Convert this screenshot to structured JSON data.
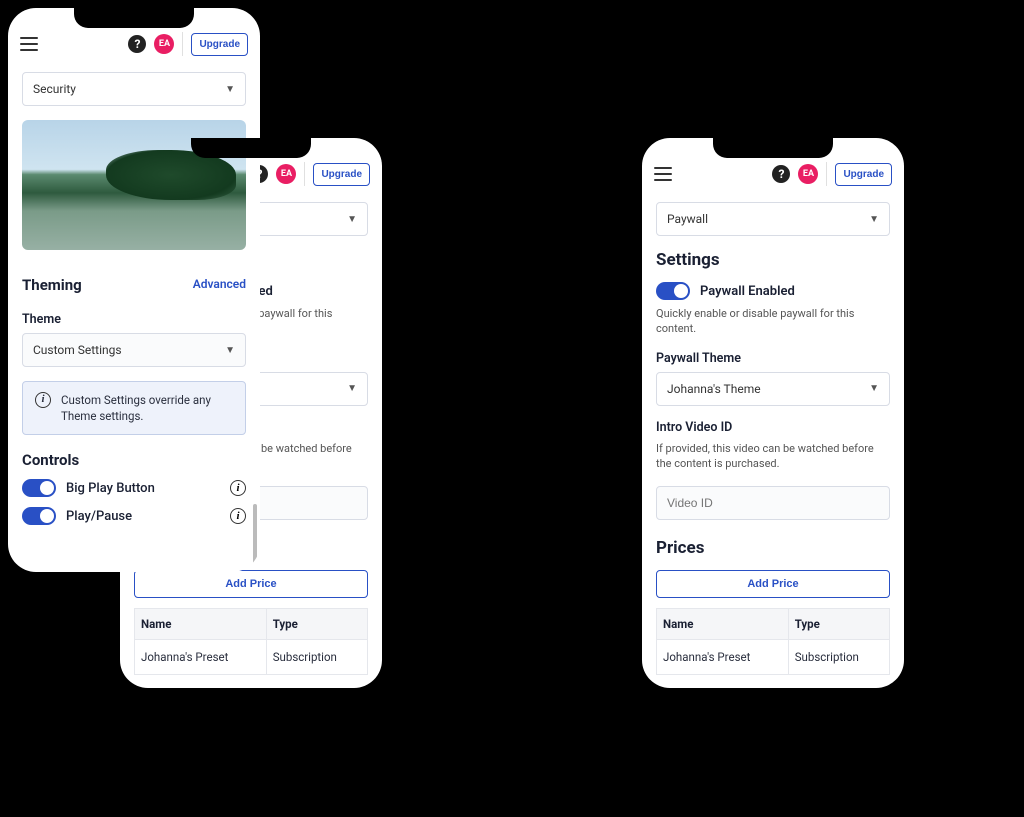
{
  "header": {
    "upgrade_label": "Upgrade",
    "avatar_text": "EA",
    "help_text": "?"
  },
  "side_phone": {
    "dropdown_value": "Paywall",
    "settings_heading": "Settings",
    "toggle_label": "Paywall Enabled",
    "toggle_helper": "Quickly enable or disable paywall for this content.",
    "theme_label": "Paywall Theme",
    "theme_value": "Johanna's Theme",
    "intro_label": "Intro Video ID",
    "intro_helper": "If provided, this video can be watched before the content is purchased.",
    "intro_placeholder": "Video ID",
    "prices_heading": "Prices",
    "add_price_label": "Add Price",
    "table": {
      "col_name": "Name",
      "col_type": "Type",
      "row_name": "Johanna's Preset",
      "row_type": "Subscription"
    }
  },
  "center_phone": {
    "dropdown_value": "Security",
    "theming_heading": "Theming",
    "advanced_link": "Advanced",
    "theme_label": "Theme",
    "theme_value": "Custom Settings",
    "info_text": "Custom Settings override any Theme settings.",
    "controls_heading": "Controls",
    "control1": "Big Play Button",
    "control2": "Play/Pause"
  }
}
